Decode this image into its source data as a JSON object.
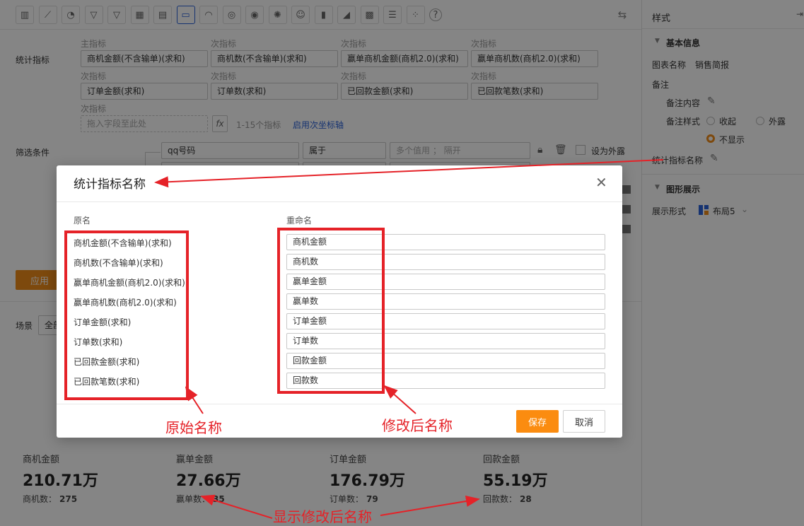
{
  "toolbar": {
    "icons": [
      "bar-chart-icon",
      "line-chart-icon",
      "pie-chart-icon",
      "funnel-icon",
      "funnel-alt-icon",
      "table-icon",
      "combo-chart-icon",
      "card-icon",
      "gauge-icon",
      "map-icon",
      "globe-map-icon",
      "radar-icon",
      "smiley-icon",
      "column-icon",
      "area-icon",
      "grid-icon",
      "list-icon",
      "scatter-icon",
      "help-icon"
    ],
    "icon_glyphs": [
      "▥",
      "⟋",
      "◔",
      "▽",
      "▽",
      "▦",
      "▤",
      "▭",
      "◠",
      "◎",
      "◉",
      "✺",
      "☺",
      "▮",
      "◢",
      "▩",
      "☰",
      "⁘",
      "?"
    ],
    "active_index": 7,
    "swap_glyph": "⇆"
  },
  "metrics": {
    "label": "统计指标",
    "main_caption": "主指标",
    "sub_caption": "次指标",
    "fields": [
      "商机金额(不含输单)(求和)",
      "商机数(不含输单)(求和)",
      "赢单商机金额(商机2.0)(求和)",
      "赢单商机数(商机2.0)(求和)",
      "订单金额(求和)",
      "订单数(求和)",
      "已回款金额(求和)",
      "已回款笔数(求和)"
    ],
    "drop_placeholder": "拖入字段至此处",
    "fx": "fx",
    "range_hint": "1-15个指标",
    "secondary_axis_link": "启用次坐标轴"
  },
  "filter": {
    "label": "筛选条件",
    "field": "qq号码",
    "operator": "属于",
    "value_placeholder": "多个值用 ； 隔开",
    "external_label": "设为外露"
  },
  "apply_label": "应用",
  "scene": {
    "label": "场景",
    "value": "全部"
  },
  "kpis": [
    {
      "title": "商机金额",
      "value": "210.71万",
      "sub_label": "商机数：",
      "sub_value": "275"
    },
    {
      "title": "赢单金额",
      "value": "27.66万",
      "sub_label": "赢单数：",
      "sub_value": "35"
    },
    {
      "title": "订单金额",
      "value": "176.79万",
      "sub_label": "订单数：",
      "sub_value": "79"
    },
    {
      "title": "回款金额",
      "value": "55.19万",
      "sub_label": "回款数：",
      "sub_value": "28"
    }
  ],
  "panel": {
    "title": "样式",
    "basic_section": "基本信息",
    "chart_name_label": "图表名称",
    "chart_name_value": "销售简报",
    "remark_label": "备注",
    "remark_content_label": "备注内容",
    "remark_style_label": "备注样式",
    "remark_options": [
      "收起",
      "外露",
      "不显示"
    ],
    "remark_selected": "不显示",
    "metric_name_label": "统计指标名称",
    "display_section": "图形展示",
    "display_mode_label": "展示形式",
    "display_mode_value": "布局5"
  },
  "modal": {
    "title": "统计指标名称",
    "original_header": "原名",
    "rename_header": "重命名",
    "original_names": [
      "商机金额(不含输单)(求和)",
      "商机数(不含输单)(求和)",
      "赢单商机金额(商机2.0)(求和)",
      "赢单商机数(商机2.0)(求和)",
      "订单金额(求和)",
      "订单数(求和)",
      "已回款金额(求和)",
      "已回款笔数(求和)"
    ],
    "renamed": [
      "商机金额",
      "商机数",
      "赢单金额",
      "赢单数",
      "订单金额",
      "订单数",
      "回款金额",
      "回款数"
    ],
    "save_label": "保存",
    "cancel_label": "取消"
  },
  "annotations": {
    "original": "原始名称",
    "renamed": "修改后名称",
    "display": "显示修改后名称",
    "color": "#e52228"
  },
  "colors": {
    "accent": "#2b62d8",
    "primary_button": "#fb8c10",
    "annotation": "#e52228"
  }
}
